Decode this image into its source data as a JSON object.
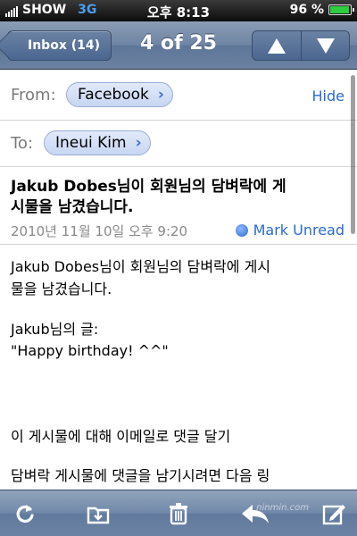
{
  "status_bar": {
    "carrier": "SHOW",
    "network": "3G",
    "time": "오후 8:13",
    "battery": "96 %",
    "battery_level": 0.96
  },
  "nav": {
    "back_label": "Inbox (14)",
    "title": "4 of 25"
  },
  "header": {
    "from_label": "From:",
    "from_name": "Facebook",
    "hide_label": "Hide",
    "to_label": "To:",
    "to_name": "Ineui Kim",
    "subject_sender": "Jakub Dobes",
    "subject_rest_line1": "님이 회원님의 담벼락에 게",
    "subject_line2": "시물을 남겼습니다.",
    "date": "2010년 11월 10일 오후 9:20",
    "mark_unread": "Mark Unread"
  },
  "body": {
    "line1": "Jakub Dobes님이 회원님의 담벼락에 게시",
    "line2": "물을 남겼습니다.",
    "line3": "Jakub님의 글:",
    "line4": "\"Happy birthday! ^^\"",
    "line5": "이 게시물에 대해 이메일로 댓글 달기",
    "line6": "담벼락 게시물에 댓글을 남기시려면 다음 링"
  },
  "toolbar": {
    "icons": [
      "refresh-icon",
      "move-folder-icon",
      "trash-icon",
      "reply-icon",
      "compose-icon"
    ],
    "watermark": "ninmin.com"
  },
  "colors": {
    "link": "#2a6ad3",
    "nav": "#6d84a3"
  }
}
